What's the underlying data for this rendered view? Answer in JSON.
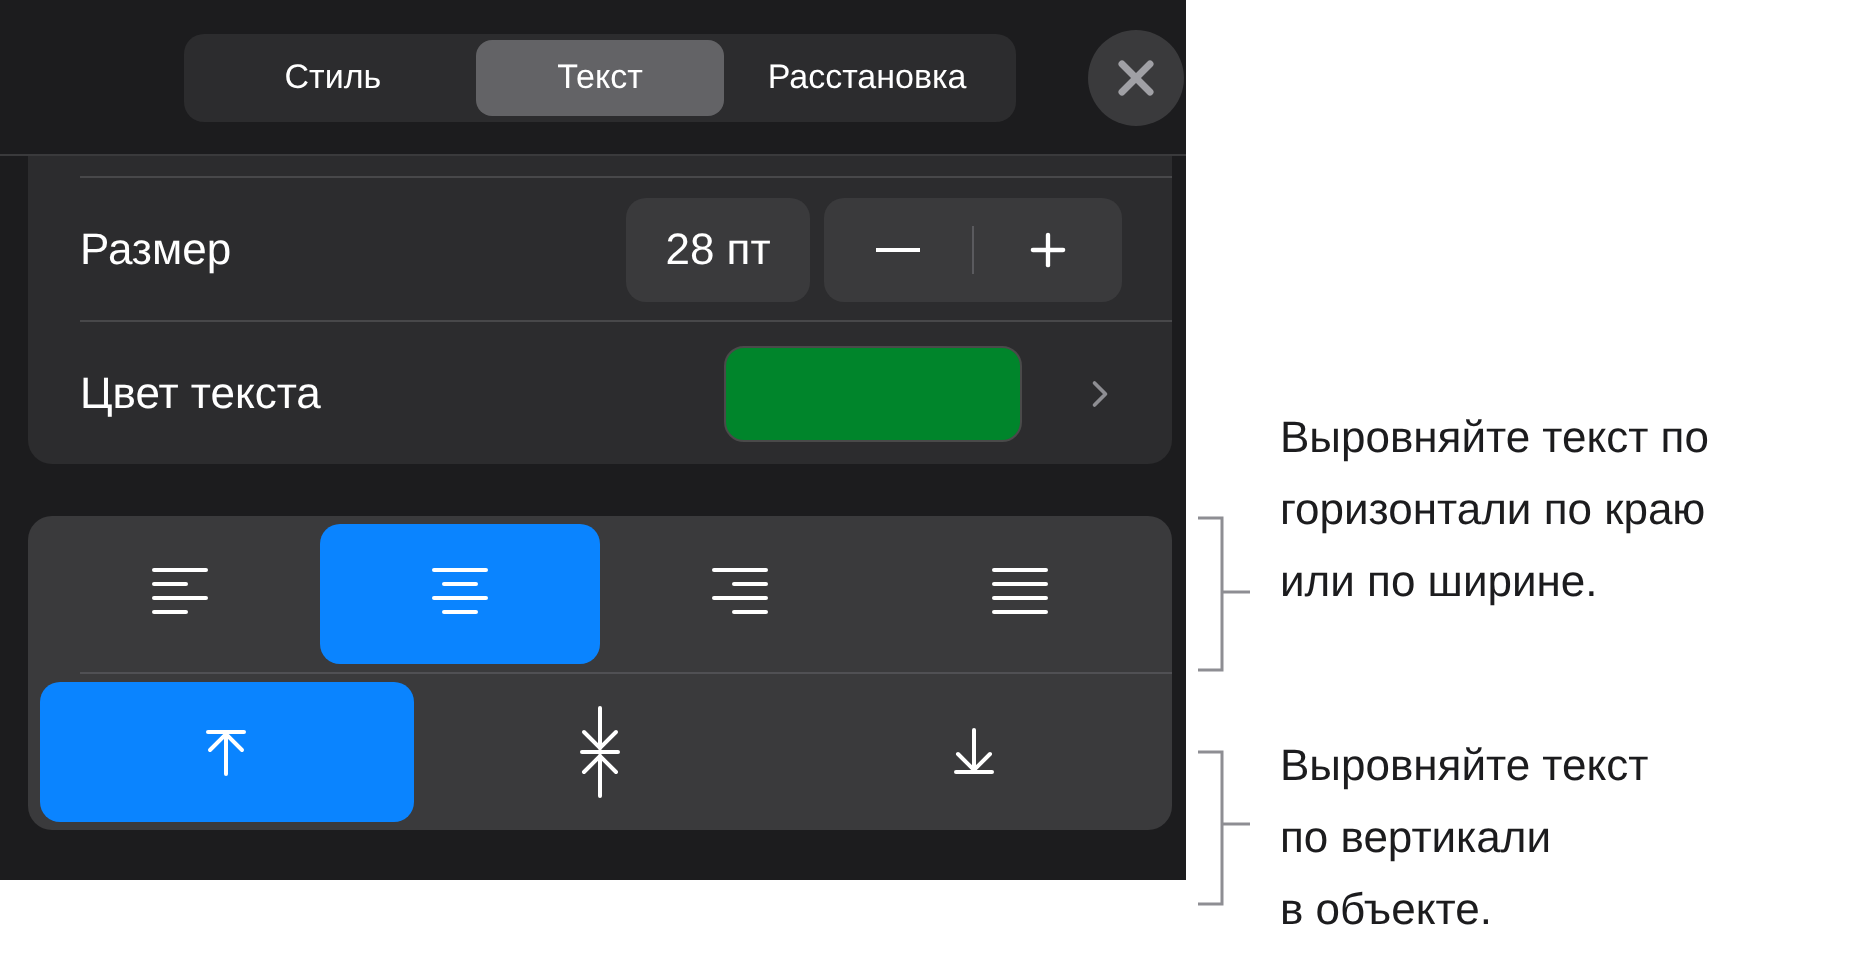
{
  "tabs": [
    {
      "label": "Стиль",
      "selected": false
    },
    {
      "label": "Текст",
      "selected": true
    },
    {
      "label": "Расстановка",
      "selected": false
    }
  ],
  "size": {
    "label": "Размер",
    "value": "28 пт"
  },
  "text_color": {
    "label": "Цвет текста",
    "color": "#00852b"
  },
  "horizontal_alignment": [
    {
      "kind": "left",
      "selected": false
    },
    {
      "kind": "center",
      "selected": true
    },
    {
      "kind": "right",
      "selected": false
    },
    {
      "kind": "justify",
      "selected": false
    }
  ],
  "vertical_alignment": [
    {
      "kind": "top",
      "selected": true
    },
    {
      "kind": "middle",
      "selected": false
    },
    {
      "kind": "bottom",
      "selected": false
    }
  ],
  "callouts": [
    {
      "lines": [
        "Выровняйте текст по",
        "горизонтали по краю",
        "или по ширине."
      ]
    },
    {
      "lines": [
        "Выровняйте текст",
        "по вертикали",
        "в объекте."
      ]
    }
  ]
}
